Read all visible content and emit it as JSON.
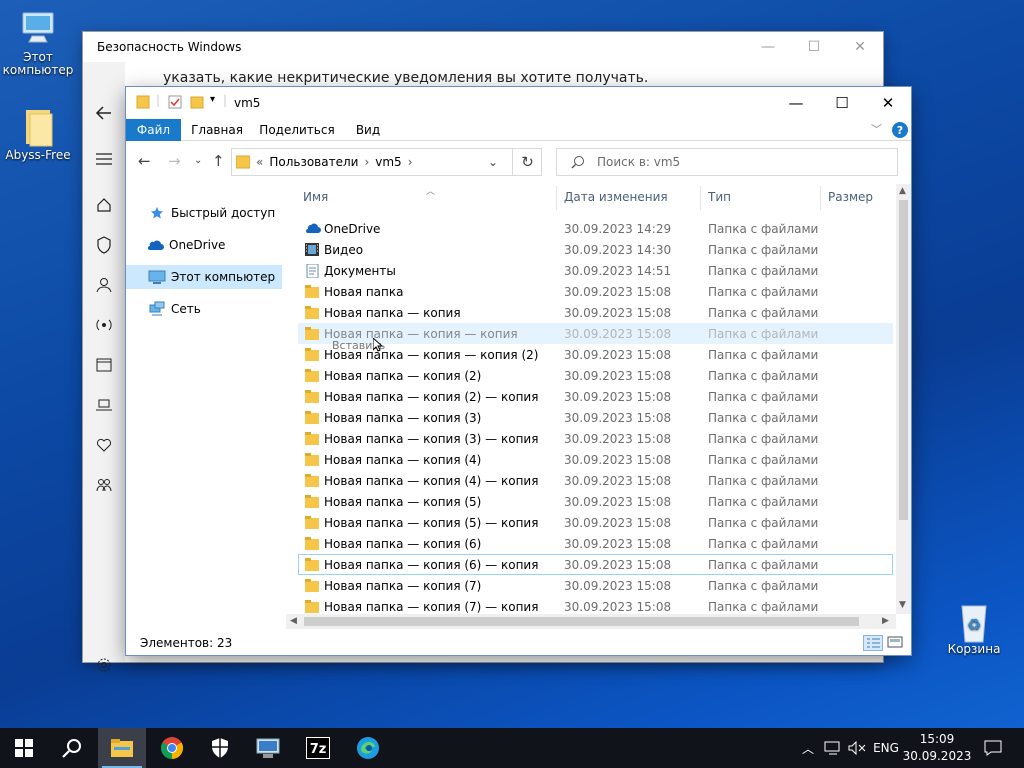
{
  "desktop": {
    "icons": [
      {
        "label": "Этот компьютер"
      },
      {
        "label": "Abyss-Free"
      },
      {
        "label": "Корзина"
      }
    ]
  },
  "security": {
    "title": "Безопасность Windows",
    "text_top": "",
    "text": "указать, какие некритические уведомления вы хотите получать."
  },
  "explorer": {
    "title": "vm5",
    "ribbon": {
      "tabs": [
        "Файл",
        "Главная",
        "Поделиться",
        "Вид"
      ],
      "help": "?"
    },
    "address": {
      "prefix": "«",
      "parts": [
        "Пользователи",
        "vm5"
      ]
    },
    "search": {
      "placeholder": "Поиск в: vm5"
    },
    "nav_pane": [
      {
        "label": "Быстрый доступ",
        "icon": "star-icon"
      },
      {
        "label": "OneDrive",
        "icon": "cloud-icon"
      },
      {
        "label": "Этот компьютер",
        "icon": "computer-icon",
        "selected": true
      },
      {
        "label": "Сеть",
        "icon": "network-icon"
      }
    ],
    "columns": [
      "Имя",
      "Дата изменения",
      "Тип",
      "Размер"
    ],
    "rows": [
      {
        "name": "OneDrive",
        "date": "30.09.2023 14:29",
        "type": "Папка с файлами",
        "icon": "onedrive"
      },
      {
        "name": "Видео",
        "date": "30.09.2023 14:30",
        "type": "Папка с файлами",
        "icon": "video"
      },
      {
        "name": "Документы",
        "date": "30.09.2023 14:51",
        "type": "Папка с файлами",
        "icon": "documents"
      },
      {
        "name": "Новая папка",
        "date": "30.09.2023 15:08",
        "type": "Папка с файлами",
        "icon": "folder"
      },
      {
        "name": "Новая папка — копия",
        "date": "30.09.2023 15:08",
        "type": "Папка с файлами",
        "icon": "folder"
      },
      {
        "name": "Новая папка — копия — копия",
        "date": "30.09.2023 15:08",
        "type": "Папка с файлами",
        "icon": "folder",
        "state": "ghost"
      },
      {
        "name": "Новая папка — копия — копия (2)",
        "date": "30.09.2023 15:08",
        "type": "Папка с файлами",
        "icon": "folder"
      },
      {
        "name": "Новая папка — копия (2)",
        "date": "30.09.2023 15:08",
        "type": "Папка с файлами",
        "icon": "folder"
      },
      {
        "name": "Новая папка — копия (2) — копия",
        "date": "30.09.2023 15:08",
        "type": "Папка с файлами",
        "icon": "folder"
      },
      {
        "name": "Новая папка — копия (3)",
        "date": "30.09.2023 15:08",
        "type": "Папка с файлами",
        "icon": "folder"
      },
      {
        "name": "Новая папка — копия (3) — копия",
        "date": "30.09.2023 15:08",
        "type": "Папка с файлами",
        "icon": "folder"
      },
      {
        "name": "Новая папка — копия (4)",
        "date": "30.09.2023 15:08",
        "type": "Папка с файлами",
        "icon": "folder"
      },
      {
        "name": "Новая папка — копия (4) — копия",
        "date": "30.09.2023 15:08",
        "type": "Папка с файлами",
        "icon": "folder"
      },
      {
        "name": "Новая папка — копия (5)",
        "date": "30.09.2023 15:08",
        "type": "Папка с файлами",
        "icon": "folder"
      },
      {
        "name": "Новая папка — копия (5) — копия",
        "date": "30.09.2023 15:08",
        "type": "Папка с файлами",
        "icon": "folder"
      },
      {
        "name": "Новая папка — копия (6)",
        "date": "30.09.2023 15:08",
        "type": "Папка с файлами",
        "icon": "folder"
      },
      {
        "name": "Новая папка — копия (6) — копия",
        "date": "30.09.2023 15:08",
        "type": "Папка с файлами",
        "icon": "folder",
        "state": "focused"
      },
      {
        "name": "Новая папка — копия (7)",
        "date": "30.09.2023 15:08",
        "type": "Папка с файлами",
        "icon": "folder"
      },
      {
        "name": "Новая папка — копия (7) — копия",
        "date": "30.09.2023 15:08",
        "type": "Папка с файлами",
        "icon": "folder"
      }
    ],
    "drag_label": "Вставить",
    "status": "Элементов: 23"
  },
  "taskbar": {
    "apps": [
      "windows-start",
      "search",
      "file-explorer",
      "chrome",
      "windows-security",
      "remote-desktop",
      "7zip",
      "edge"
    ],
    "lang": "ENG",
    "time": "15:09",
    "date": "30.09.2023"
  },
  "colors": {
    "accent": "#1979ca",
    "selection": "#cce8ff",
    "folder": "#f6c64a",
    "taskbar": "#10131a"
  }
}
